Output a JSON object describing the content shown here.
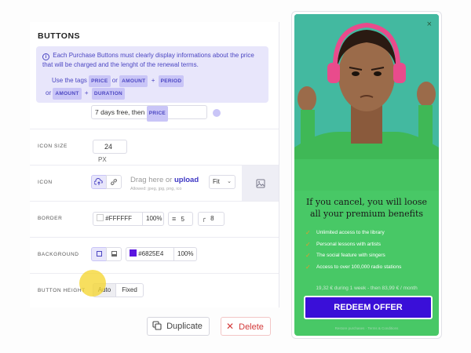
{
  "editor": {
    "section_title": "BUTTONS",
    "info": {
      "text": "Each Purchase Buttons must clearly display informations about the price that will be charged and the lenght of the renewal terms.",
      "use_tags_label": "Use the tags",
      "or_label": "or",
      "tag_price": "PRICE",
      "tag_amount": "AMOUNT",
      "tag_period": "PERIOD",
      "tag_duration": "DURATION",
      "plus": "+"
    },
    "text_field": {
      "value_prefix": "7 days free, then",
      "tag": "PRICE"
    },
    "icon_size": {
      "label": "ICON SIZE",
      "value": "24",
      "unit": "PX"
    },
    "icon": {
      "label": "ICON",
      "upload_prefix": "Drag here or",
      "upload_link": "upload",
      "allowed": "Allowed: jpeg, jpg, png, ico",
      "fit_value": "Fit"
    },
    "border": {
      "label": "BORDER",
      "color": "#FFFFFF",
      "opacity": "100%",
      "width": "5",
      "radius": "8"
    },
    "background": {
      "label": "BACKGROUND",
      "color": "#6825E4",
      "opacity": "100%",
      "swatch": "#5a16e0"
    },
    "button_height": {
      "label": "BUTTON HEIGHT",
      "options": [
        "Auto",
        "Fixed"
      ],
      "selected": "Auto"
    },
    "actions": {
      "duplicate": "Duplicate",
      "delete": "Delete"
    }
  },
  "preview": {
    "headline": "If you cancel, you will loose all your premium benefits",
    "benefits": [
      "Unlimited access to the library",
      "Personal lessons with artists",
      "The social feature with singers",
      "Access to over 100,000 radio stations"
    ],
    "price_line": "19,32 € during 1 week - then 83,99 € / month",
    "cta": "REDEEM OFFER",
    "footer": "Restore purchases · Terms & Conditions",
    "close": "×"
  },
  "icons": {
    "info": "info-icon",
    "upload": "upload-icon",
    "link": "link-icon",
    "image": "image-icon",
    "duplicate": "duplicate-icon",
    "delete": "delete-icon",
    "check": "check-icon",
    "close": "close-icon"
  },
  "colors": {
    "accent": "#4b46c2",
    "preview_bg": "#48c866",
    "cta_bg": "#3a0fd8",
    "delete": "#d33a3a"
  }
}
